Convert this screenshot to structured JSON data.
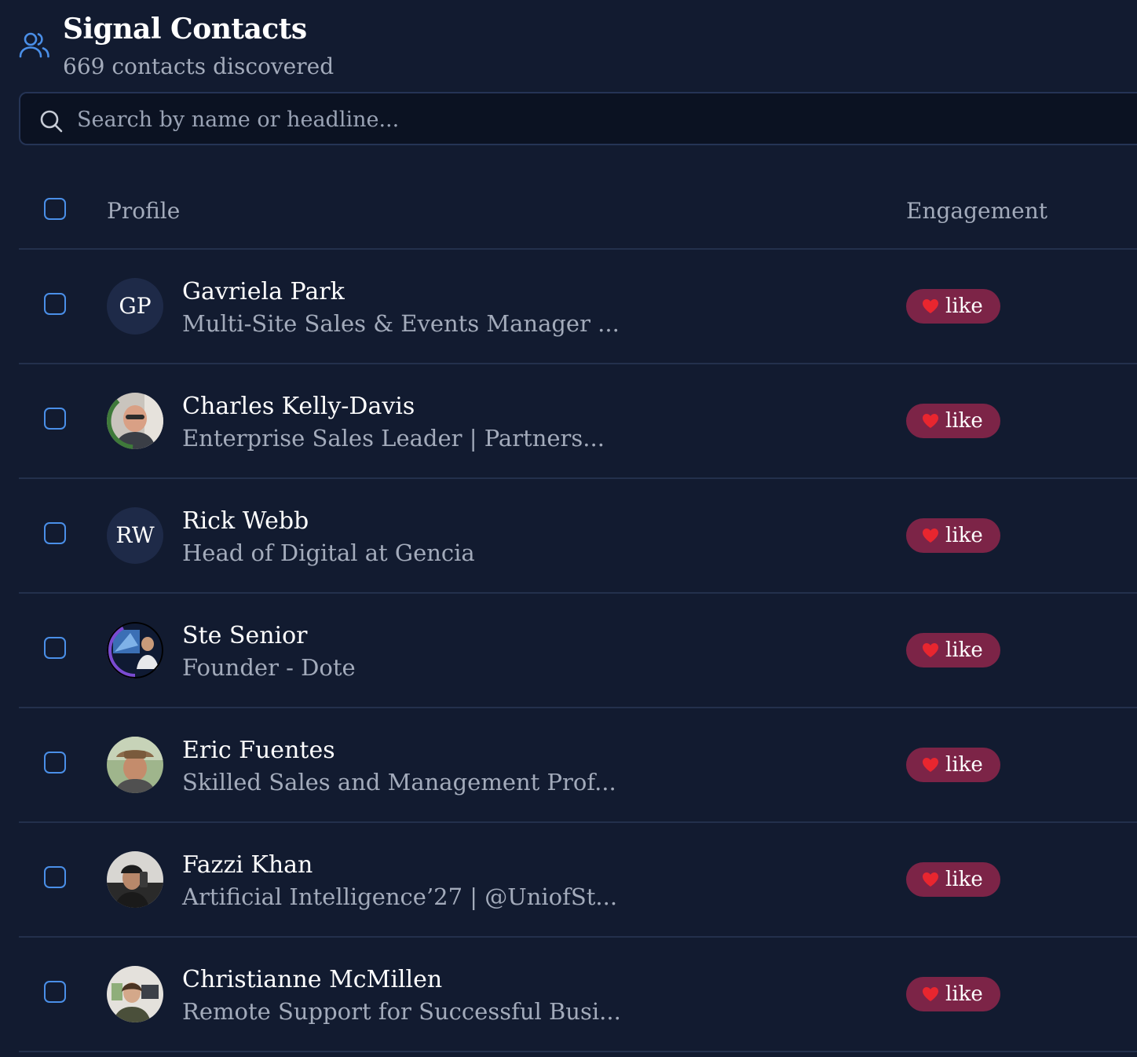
{
  "header": {
    "icon": "users-icon",
    "title": "Signal Contacts",
    "subtitle": "669 contacts discovered"
  },
  "search": {
    "icon": "search-icon",
    "placeholder": "Search by name or headline...",
    "value": ""
  },
  "table": {
    "columns": {
      "profile": "Profile",
      "engagement": "Engagement"
    },
    "rows": [
      {
        "initials": "GP",
        "name": "Gavriela Park",
        "headline": "Multi-Site Sales & Events Manager ...",
        "engagement": "like",
        "avatar": "initials"
      },
      {
        "initials": "",
        "name": "Charles Kelly-Davis",
        "headline": "Enterprise Sales Leader | Partners...",
        "engagement": "like",
        "avatar": "photo"
      },
      {
        "initials": "RW",
        "name": "Rick Webb",
        "headline": "Head of Digital at Gencia",
        "engagement": "like",
        "avatar": "initials"
      },
      {
        "initials": "",
        "name": "Ste Senior",
        "headline": "Founder - Dote",
        "engagement": "like",
        "avatar": "photo"
      },
      {
        "initials": "",
        "name": "Eric Fuentes",
        "headline": "Skilled Sales and Management Prof...",
        "engagement": "like",
        "avatar": "photo"
      },
      {
        "initials": "",
        "name": "Fazzi Khan",
        "headline": "Artificial Intelligence’27 | @UniofSt...",
        "engagement": "like",
        "avatar": "photo"
      },
      {
        "initials": "",
        "name": "Christianne McMillen",
        "headline": "Remote Support for Successful Busi...",
        "engagement": "like",
        "avatar": "photo"
      }
    ]
  },
  "colors": {
    "background": "#121b30",
    "accent": "#4a8fe8",
    "badge": "#7c2447",
    "heart": "#e8262f"
  }
}
